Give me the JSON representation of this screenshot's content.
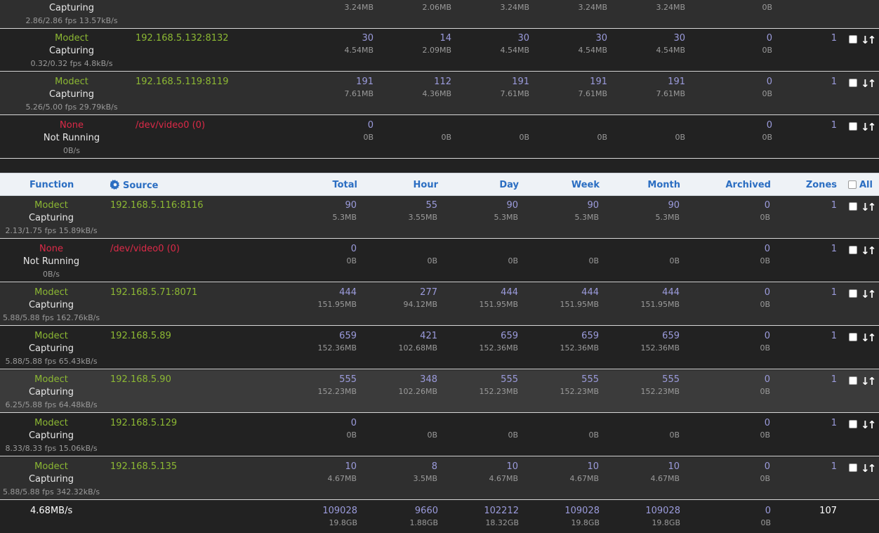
{
  "header": {
    "function": "Function",
    "source": "Source",
    "total": "Total",
    "hour": "Hour",
    "day": "Day",
    "week": "Week",
    "month": "Month",
    "archived": "Archived",
    "zones": "Zones",
    "all": "All"
  },
  "top_rows": [
    {
      "function": "",
      "status": "Capturing",
      "rate": "2.86/2.86 fps 13.57kB/s",
      "source": "",
      "total": "",
      "total_size": "3.24MB",
      "hour": "",
      "hour_size": "2.06MB",
      "day": "",
      "day_size": "3.24MB",
      "week": "",
      "week_size": "3.24MB",
      "month": "",
      "month_size": "3.24MB",
      "archived": "",
      "archived_size": "0B",
      "zones": ""
    },
    {
      "function": "Modect",
      "status": "Capturing",
      "rate": "0.32/0.32 fps 4.8kB/s",
      "source": "192.168.5.132:8132",
      "total": "30",
      "total_size": "4.54MB",
      "hour": "14",
      "hour_size": "2.09MB",
      "day": "30",
      "day_size": "4.54MB",
      "week": "30",
      "week_size": "4.54MB",
      "month": "30",
      "month_size": "4.54MB",
      "archived": "0",
      "archived_size": "0B",
      "zones": "1"
    },
    {
      "function": "Modect",
      "status": "Capturing",
      "rate": "5.26/5.00 fps 29.79kB/s",
      "source": "192.168.5.119:8119",
      "total": "191",
      "total_size": "7.61MB",
      "hour": "112",
      "hour_size": "4.36MB",
      "day": "191",
      "day_size": "7.61MB",
      "week": "191",
      "week_size": "7.61MB",
      "month": "191",
      "month_size": "7.61MB",
      "archived": "0",
      "archived_size": "0B",
      "zones": "1"
    },
    {
      "function": "None",
      "status": "Not Running",
      "rate": "0B/s",
      "source": "/dev/video0 (0)",
      "total": "0",
      "total_size": "0B",
      "hour": "",
      "hour_size": "0B",
      "day": "",
      "day_size": "0B",
      "week": "",
      "week_size": "0B",
      "month": "",
      "month_size": "0B",
      "archived": "0",
      "archived_size": "0B",
      "zones": "1"
    }
  ],
  "rows": [
    {
      "function": "Modect",
      "status": "Capturing",
      "rate": "2.13/1.75 fps 15.89kB/s",
      "source": "192.168.5.116:8116",
      "total": "90",
      "total_size": "5.3MB",
      "hour": "55",
      "hour_size": "3.55MB",
      "day": "90",
      "day_size": "5.3MB",
      "week": "90",
      "week_size": "5.3MB",
      "month": "90",
      "month_size": "5.3MB",
      "archived": "0",
      "archived_size": "0B",
      "zones": "1"
    },
    {
      "function": "None",
      "status": "Not Running",
      "rate": "0B/s",
      "source": "/dev/video0 (0)",
      "total": "0",
      "total_size": "0B",
      "hour": "",
      "hour_size": "0B",
      "day": "",
      "day_size": "0B",
      "week": "",
      "week_size": "0B",
      "month": "",
      "month_size": "0B",
      "archived": "0",
      "archived_size": "0B",
      "zones": "1"
    },
    {
      "function": "Modect",
      "status": "Capturing",
      "rate": "5.88/5.88 fps 162.76kB/s",
      "source": "192.168.5.71:8071",
      "total": "444",
      "total_size": "151.95MB",
      "hour": "277",
      "hour_size": "94.12MB",
      "day": "444",
      "day_size": "151.95MB",
      "week": "444",
      "week_size": "151.95MB",
      "month": "444",
      "month_size": "151.95MB",
      "archived": "0",
      "archived_size": "0B",
      "zones": "1"
    },
    {
      "function": "Modect",
      "status": "Capturing",
      "rate": "5.88/5.88 fps 65.43kB/s",
      "source": "192.168.5.89",
      "total": "659",
      "total_size": "152.36MB",
      "hour": "421",
      "hour_size": "102.68MB",
      "day": "659",
      "day_size": "152.36MB",
      "week": "659",
      "week_size": "152.36MB",
      "month": "659",
      "month_size": "152.36MB",
      "archived": "0",
      "archived_size": "0B",
      "zones": "1"
    },
    {
      "function": "Modect",
      "status": "Capturing",
      "rate": "6.25/5.88 fps 64.48kB/s",
      "source": "192.168.5.90",
      "total": "555",
      "total_size": "152.23MB",
      "hour": "348",
      "hour_size": "102.26MB",
      "day": "555",
      "day_size": "152.23MB",
      "week": "555",
      "week_size": "152.23MB",
      "month": "555",
      "month_size": "152.23MB",
      "archived": "0",
      "archived_size": "0B",
      "zones": "1"
    },
    {
      "function": "Modect",
      "status": "Capturing",
      "rate": "8.33/8.33 fps 15.06kB/s",
      "source": "192.168.5.129",
      "total": "0",
      "total_size": "0B",
      "hour": "",
      "hour_size": "0B",
      "day": "",
      "day_size": "0B",
      "week": "",
      "week_size": "0B",
      "month": "",
      "month_size": "0B",
      "archived": "0",
      "archived_size": "0B",
      "zones": "1"
    },
    {
      "function": "Modect",
      "status": "Capturing",
      "rate": "5.88/5.88 fps 342.32kB/s",
      "source": "192.168.5.135",
      "total": "10",
      "total_size": "4.67MB",
      "hour": "8",
      "hour_size": "3.5MB",
      "day": "10",
      "day_size": "4.67MB",
      "week": "10",
      "week_size": "4.67MB",
      "month": "10",
      "month_size": "4.67MB",
      "archived": "0",
      "archived_size": "0B",
      "zones": "1"
    }
  ],
  "footer": {
    "bandwidth": "4.68MB/s",
    "total": "109028",
    "total_size": "19.8GB",
    "hour": "9660",
    "hour_size": "1.88GB",
    "day": "102212",
    "day_size": "18.32GB",
    "week": "109028",
    "week_size": "19.8GB",
    "month": "109028",
    "month_size": "19.8GB",
    "archived": "0",
    "archived_size": "0B",
    "zones": "107"
  },
  "colors": {
    "function_active": "#8cb833",
    "function_none": "#dc2a48",
    "numbers": "#9b9bdc",
    "header_text": "#2b6ec2",
    "header_bg": "#eef2f6"
  },
  "icons": {
    "source_header": "gear-icon",
    "row_sort": "sort-arrows-icon",
    "row_select": "checkbox"
  }
}
